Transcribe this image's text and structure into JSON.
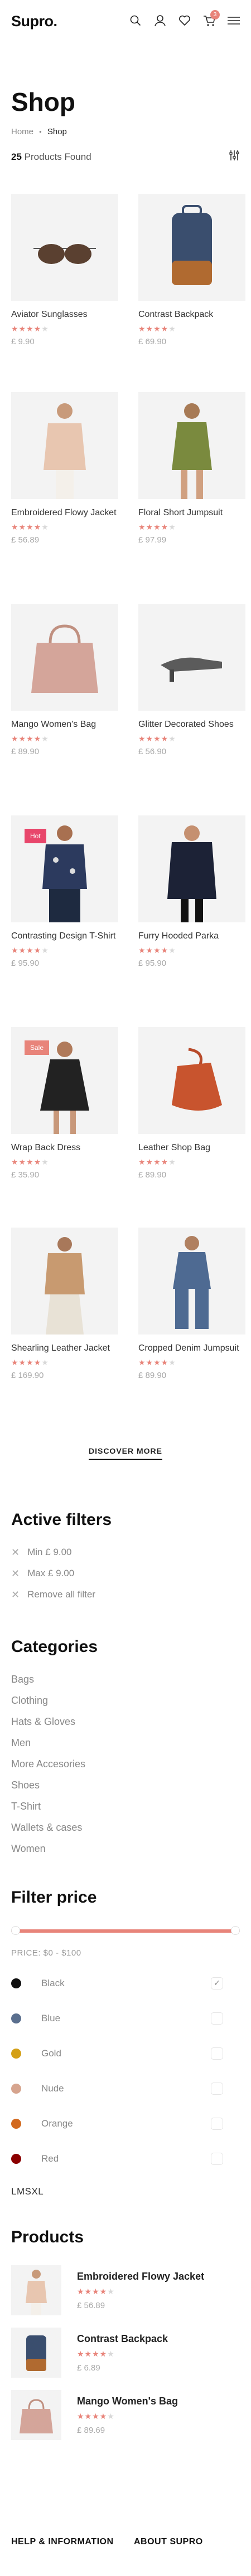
{
  "header": {
    "logo": "Supro.",
    "cart_count": "3"
  },
  "page": {
    "title": "Shop"
  },
  "breadcrumb": {
    "home": "Home",
    "current": "Shop"
  },
  "results": {
    "count": "25",
    "label": "Products Found"
  },
  "products": [
    {
      "name": "Aviator Sunglasses",
      "rating": 4,
      "price": "£ 9.90",
      "tag": ""
    },
    {
      "name": "Contrast Backpack",
      "rating": 4,
      "price": "£ 69.90",
      "tag": ""
    },
    {
      "name": "Embroidered Flowy Jacket",
      "rating": 4,
      "price": "£ 56.89",
      "tag": ""
    },
    {
      "name": "Floral Short Jumpsuit",
      "rating": 4,
      "price": "£ 97.99",
      "tag": ""
    },
    {
      "name": "Mango Women's Bag",
      "rating": 4,
      "price": "£ 89.90",
      "tag": ""
    },
    {
      "name": "Glitter Decorated Shoes",
      "rating": 4,
      "price": "£ 56.90",
      "tag": ""
    },
    {
      "name": "Contrasting Design T-Shirt",
      "rating": 4,
      "price": "£ 95.90",
      "tag": "Hot"
    },
    {
      "name": "Furry Hooded Parka",
      "rating": 4,
      "price": "£ 95.90",
      "tag": ""
    },
    {
      "name": "Wrap Back Dress",
      "rating": 4,
      "price": "£ 35.90",
      "tag": "Sale"
    },
    {
      "name": "Leather Shop Bag",
      "rating": 4,
      "price": "£ 89.90",
      "tag": ""
    },
    {
      "name": "Shearling Leather Jacket",
      "rating": 4,
      "price": "£ 169.90",
      "tag": ""
    },
    {
      "name": "Cropped Denim Jumpsuit",
      "rating": 4,
      "price": "£ 89.90",
      "tag": ""
    }
  ],
  "discover_more": "DISCOVER MORE",
  "active_filters": {
    "title": "Active filters",
    "items": [
      "Min £ 9.00",
      "Max £ 9.00",
      "Remove all filter"
    ]
  },
  "categories": {
    "title": "Categories",
    "items": [
      "Bags",
      "Clothing",
      "Hats & Gloves",
      "Men",
      "More Accesories",
      "Shoes",
      "T-Shirt",
      "Wallets & cases",
      "Women"
    ]
  },
  "filter_price": {
    "title": "Filter price",
    "label": "PRICE: $0 - $100"
  },
  "colors": [
    {
      "name": "Black",
      "hex": "#111111",
      "checked": true
    },
    {
      "name": "Blue",
      "hex": "#5a6f8e",
      "checked": false
    },
    {
      "name": "Gold",
      "hex": "#d4a017",
      "checked": false
    },
    {
      "name": "Nude",
      "hex": "#d6a48e",
      "checked": false
    },
    {
      "name": "Orange",
      "hex": "#d2691e",
      "checked": false
    },
    {
      "name": "Red",
      "hex": "#8b0000",
      "checked": false
    }
  ],
  "sizes": "LMSXL",
  "side_products": {
    "title": "Products",
    "items": [
      {
        "name": "Embroidered Flowy Jacket",
        "rating": 4,
        "price": "£ 56.89"
      },
      {
        "name": "Contrast Backpack",
        "rating": 4,
        "price": "£ 6.89"
      },
      {
        "name": "Mango Women's Bag",
        "rating": 4,
        "price": "£ 89.69"
      }
    ]
  },
  "footer": {
    "col1": "HELP & INFORMATION",
    "col2": "ABOUT SUPRO"
  },
  "accent": "#e8847a"
}
